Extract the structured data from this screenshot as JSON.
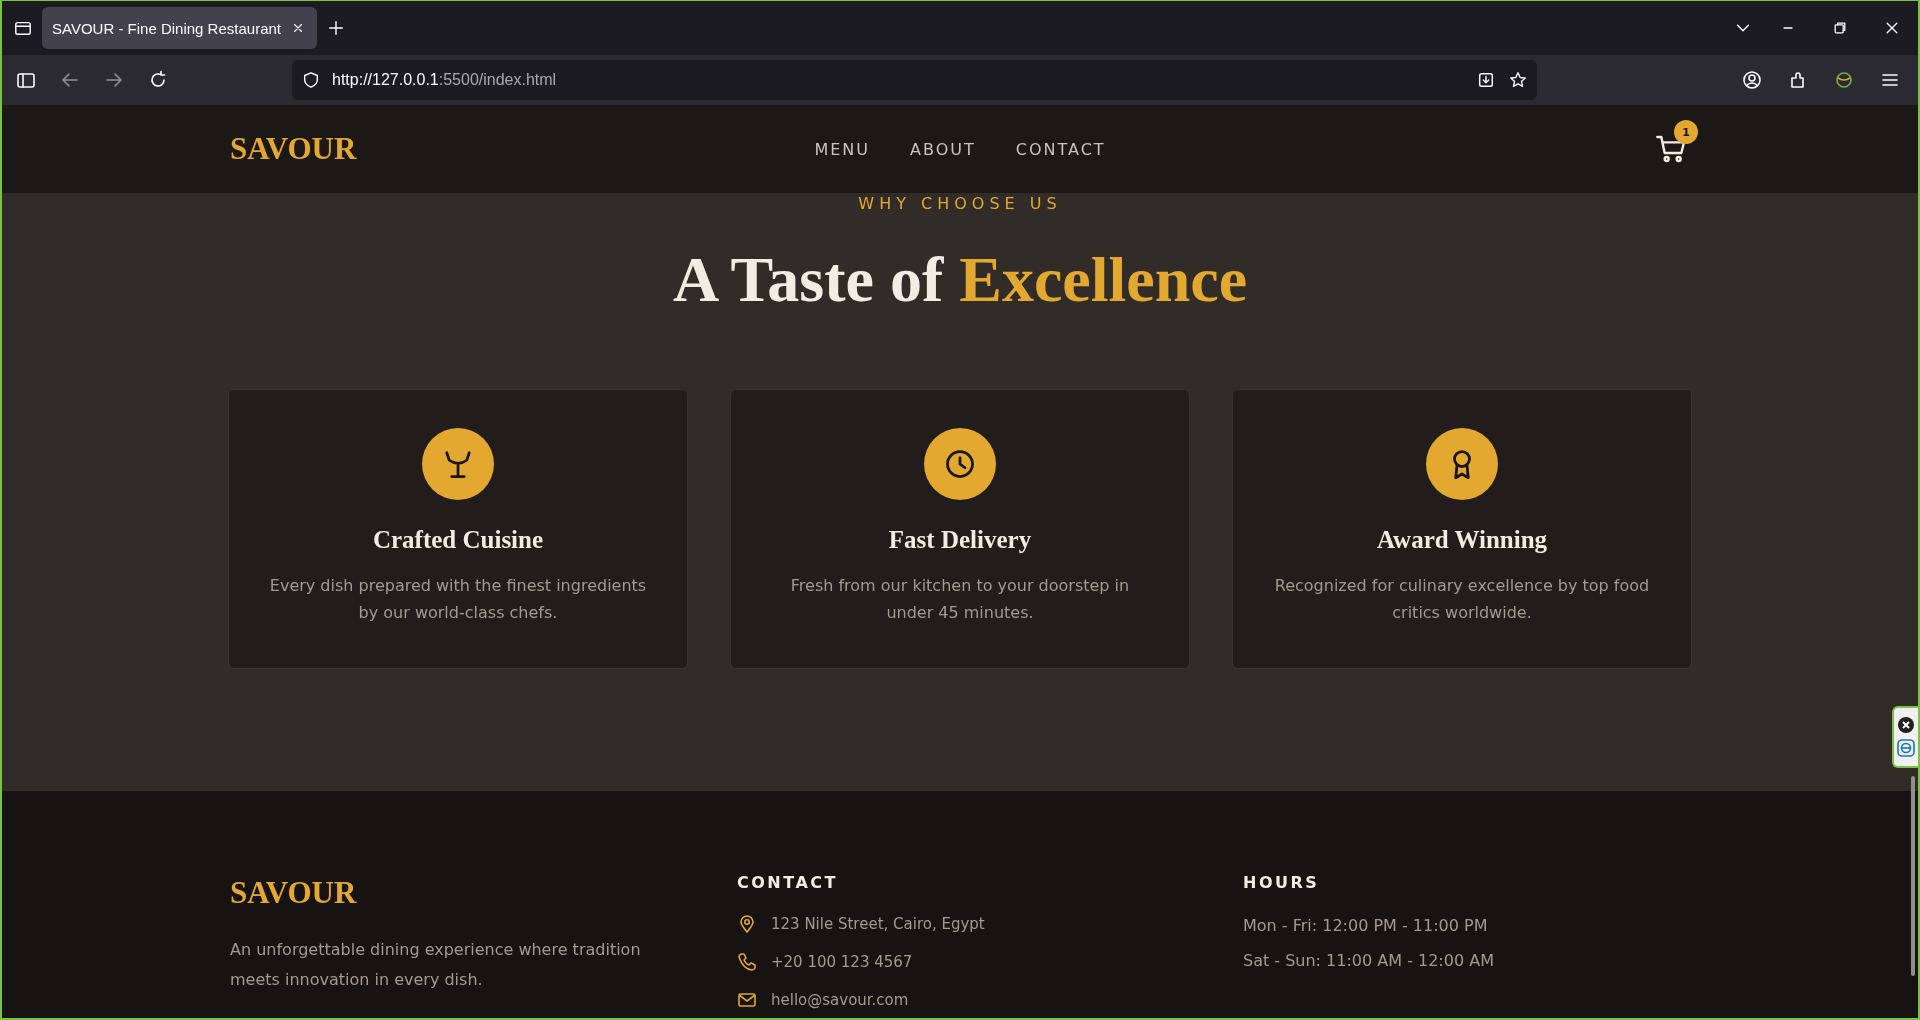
{
  "browser": {
    "tab_title": "SAVOUR - Fine Dining Restaurant",
    "url_host": "http://127.0.0.1",
    "url_rest": ":5500/index.html"
  },
  "header": {
    "brand": "SAVOUR",
    "nav": [
      "MENU",
      "ABOUT",
      "CONTACT"
    ],
    "cart_count": "1"
  },
  "features": {
    "eyebrow": "WHY CHOOSE US",
    "heading": "A Taste of ",
    "heading_highlight": "Excellence",
    "cards": [
      {
        "kind": "glass",
        "title": "Crafted Cuisine",
        "text": "Every dish prepared with the finest ingredients by our world-class chefs."
      },
      {
        "kind": "clock",
        "title": "Fast Delivery",
        "text": "Fresh from our kitchen to your doorstep in under 45 minutes."
      },
      {
        "kind": "award",
        "title": "Award Winning",
        "text": "Recognized for culinary excellence by top food critics worldwide."
      }
    ]
  },
  "footer": {
    "brand": "SAVOUR",
    "tagline": "An unforgettable dining experience where tradition meets innovation in every dish.",
    "contact_heading": "CONTACT",
    "contact": [
      {
        "kind": "location",
        "text": "123 Nile Street, Cairo, Egypt"
      },
      {
        "kind": "phone",
        "text": "+20 100 123 4567"
      },
      {
        "kind": "email",
        "text": "hello@savour.com"
      }
    ],
    "hours_heading": "HOURS",
    "hours": [
      "Mon - Fri: 12:00 PM - 11:00 PM",
      "Sat - Sun: 11:00 AM - 12:00 AM"
    ]
  }
}
